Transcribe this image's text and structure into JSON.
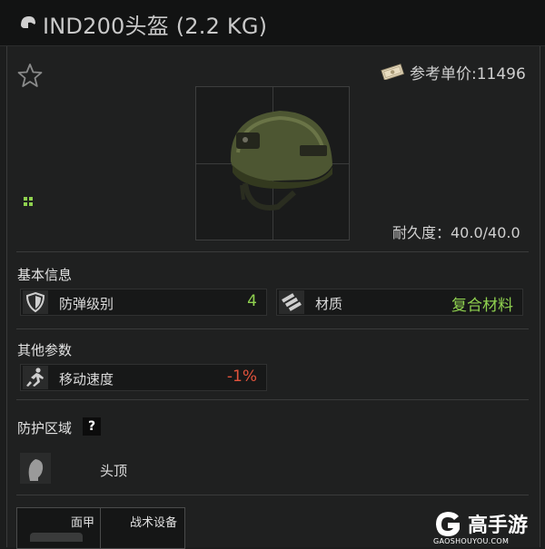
{
  "header": {
    "title": "IND200头盔 (2.2 KG)",
    "icon": "helmet-icon"
  },
  "item": {
    "favorite_icon": "star-outline-icon",
    "price_icon": "money-icon",
    "price_text": "参考单价:11496",
    "image": "helmet-image",
    "rarity_icon": "green-grid-icon",
    "durability_text": "耐久度：40.0/40.0"
  },
  "basic_info": {
    "title": "基本信息",
    "attributes": [
      {
        "icon": "shield-icon",
        "label": "防弹级别",
        "value": "4",
        "color": "#8fd14f"
      },
      {
        "icon": "material-icon",
        "label": "材质",
        "value": "复合材料",
        "color": "#8fd14f"
      }
    ]
  },
  "other_params": {
    "title": "其他参数",
    "attributes": [
      {
        "icon": "running-person-icon",
        "label": "移动速度",
        "value": "-1%",
        "color": "#e2533c"
      }
    ]
  },
  "protection": {
    "title": "防护区域",
    "help_label": "?",
    "zone_icon": "head-silhouette-icon",
    "zone_label": "头顶"
  },
  "slots": {
    "labels": [
      "面甲",
      "战术设备"
    ]
  },
  "watermark": {
    "name": "高手游",
    "url": "GAOSHOUYOU.COM"
  },
  "colors": {
    "positive": "#8fd14f",
    "negative": "#e2533c",
    "background": "#1f2020"
  }
}
